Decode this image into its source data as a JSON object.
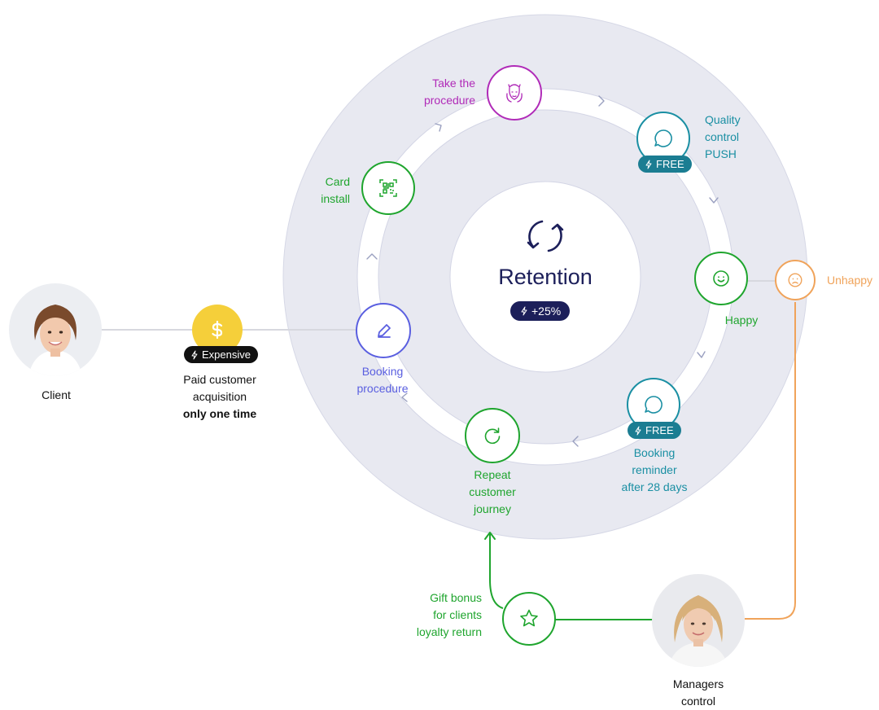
{
  "center": {
    "title": "Retention",
    "badge": "+25%"
  },
  "acquisition": {
    "badge": "Expensive",
    "line1": "Paid customer",
    "line2": "acquisition",
    "line3": "only one time"
  },
  "client": {
    "label": "Client"
  },
  "steps": {
    "booking_procedure": [
      "Booking",
      "procedure"
    ],
    "card_install": [
      "Card",
      "install"
    ],
    "take_procedure": [
      "Take the",
      "procedure"
    ],
    "quality_control": [
      "Quality",
      "control",
      "PUSH"
    ],
    "happy": "Happy",
    "unhappy": "Unhappy",
    "booking_reminder": [
      "Booking",
      "reminder",
      "after 28 days"
    ],
    "repeat_journey": [
      "Repeat",
      "customer",
      "journey"
    ]
  },
  "free_badge": "FREE",
  "gift": [
    "Gift bonus",
    "for clients",
    "loyalty return"
  ],
  "managers": [
    "Managers",
    "control"
  ],
  "colors": {
    "ring": "#e6e7f0",
    "ring_border": "#cfd1e3",
    "green": "#1fa52e",
    "teal": "#1a8fa3",
    "teal_badge": "#1b7d92",
    "purple": "#b02bb8",
    "blue": "#5a5fe0",
    "orange": "#f0a35a",
    "navy": "#1c1f5a",
    "gold": "#f5cf3a",
    "black": "#111111"
  },
  "icons": [
    "dollar-icon",
    "bolt-icon",
    "pencil-icon",
    "qr-code-icon",
    "face-icon",
    "chat-bubble-icon",
    "smile-icon",
    "sad-icon",
    "refresh-icon",
    "star-icon",
    "retention-cycle-icon"
  ]
}
